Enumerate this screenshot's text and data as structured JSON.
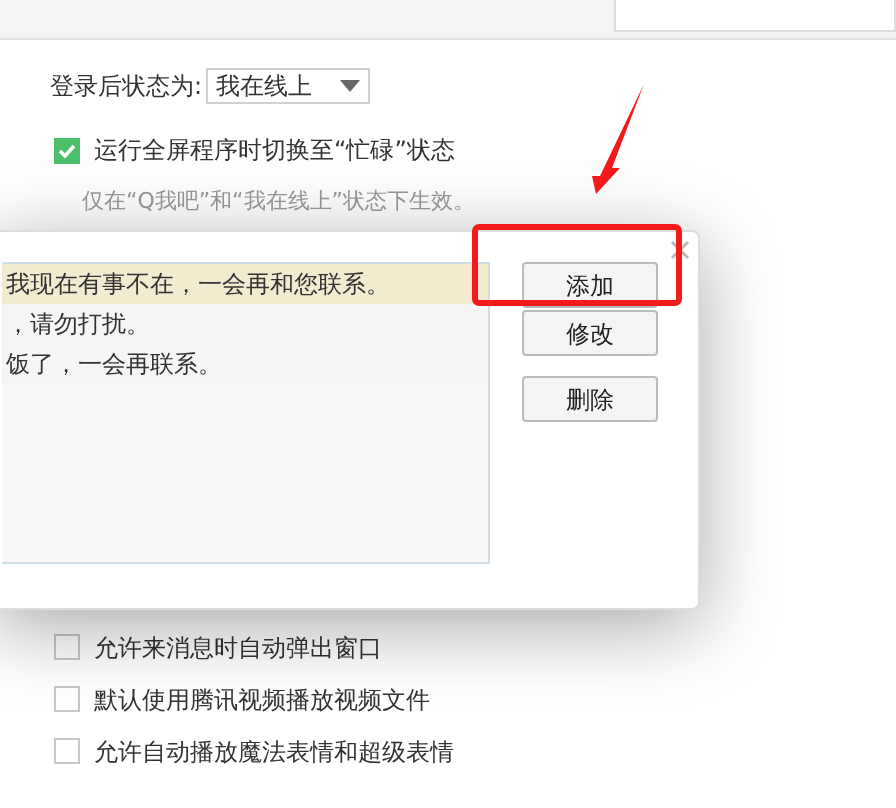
{
  "status_setting": {
    "label": "登录后状态为:",
    "value": "我在线上"
  },
  "fullscreen_option": {
    "label": "运行全屏程序时切换至“忙碌”状态",
    "checked": true,
    "hint": "仅在“Q我吧”和“我在线上”状态下生效。"
  },
  "dialog": {
    "replies": [
      {
        "text": "我现在有事不在，一会再和您联系。",
        "selected": true
      },
      {
        "text": "，请勿打扰。",
        "selected": false
      },
      {
        "text": "饭了，一会再联系。",
        "selected": false
      }
    ],
    "buttons": [
      "添加",
      "修改",
      "删除"
    ]
  },
  "options": [
    {
      "label": "允许来消息时自动弹出窗口",
      "checked": false
    },
    {
      "label": "默认使用腾讯视频播放视频文件",
      "checked": false
    },
    {
      "label": "允许自动播放魔法表情和超级表情",
      "checked": false
    }
  ]
}
